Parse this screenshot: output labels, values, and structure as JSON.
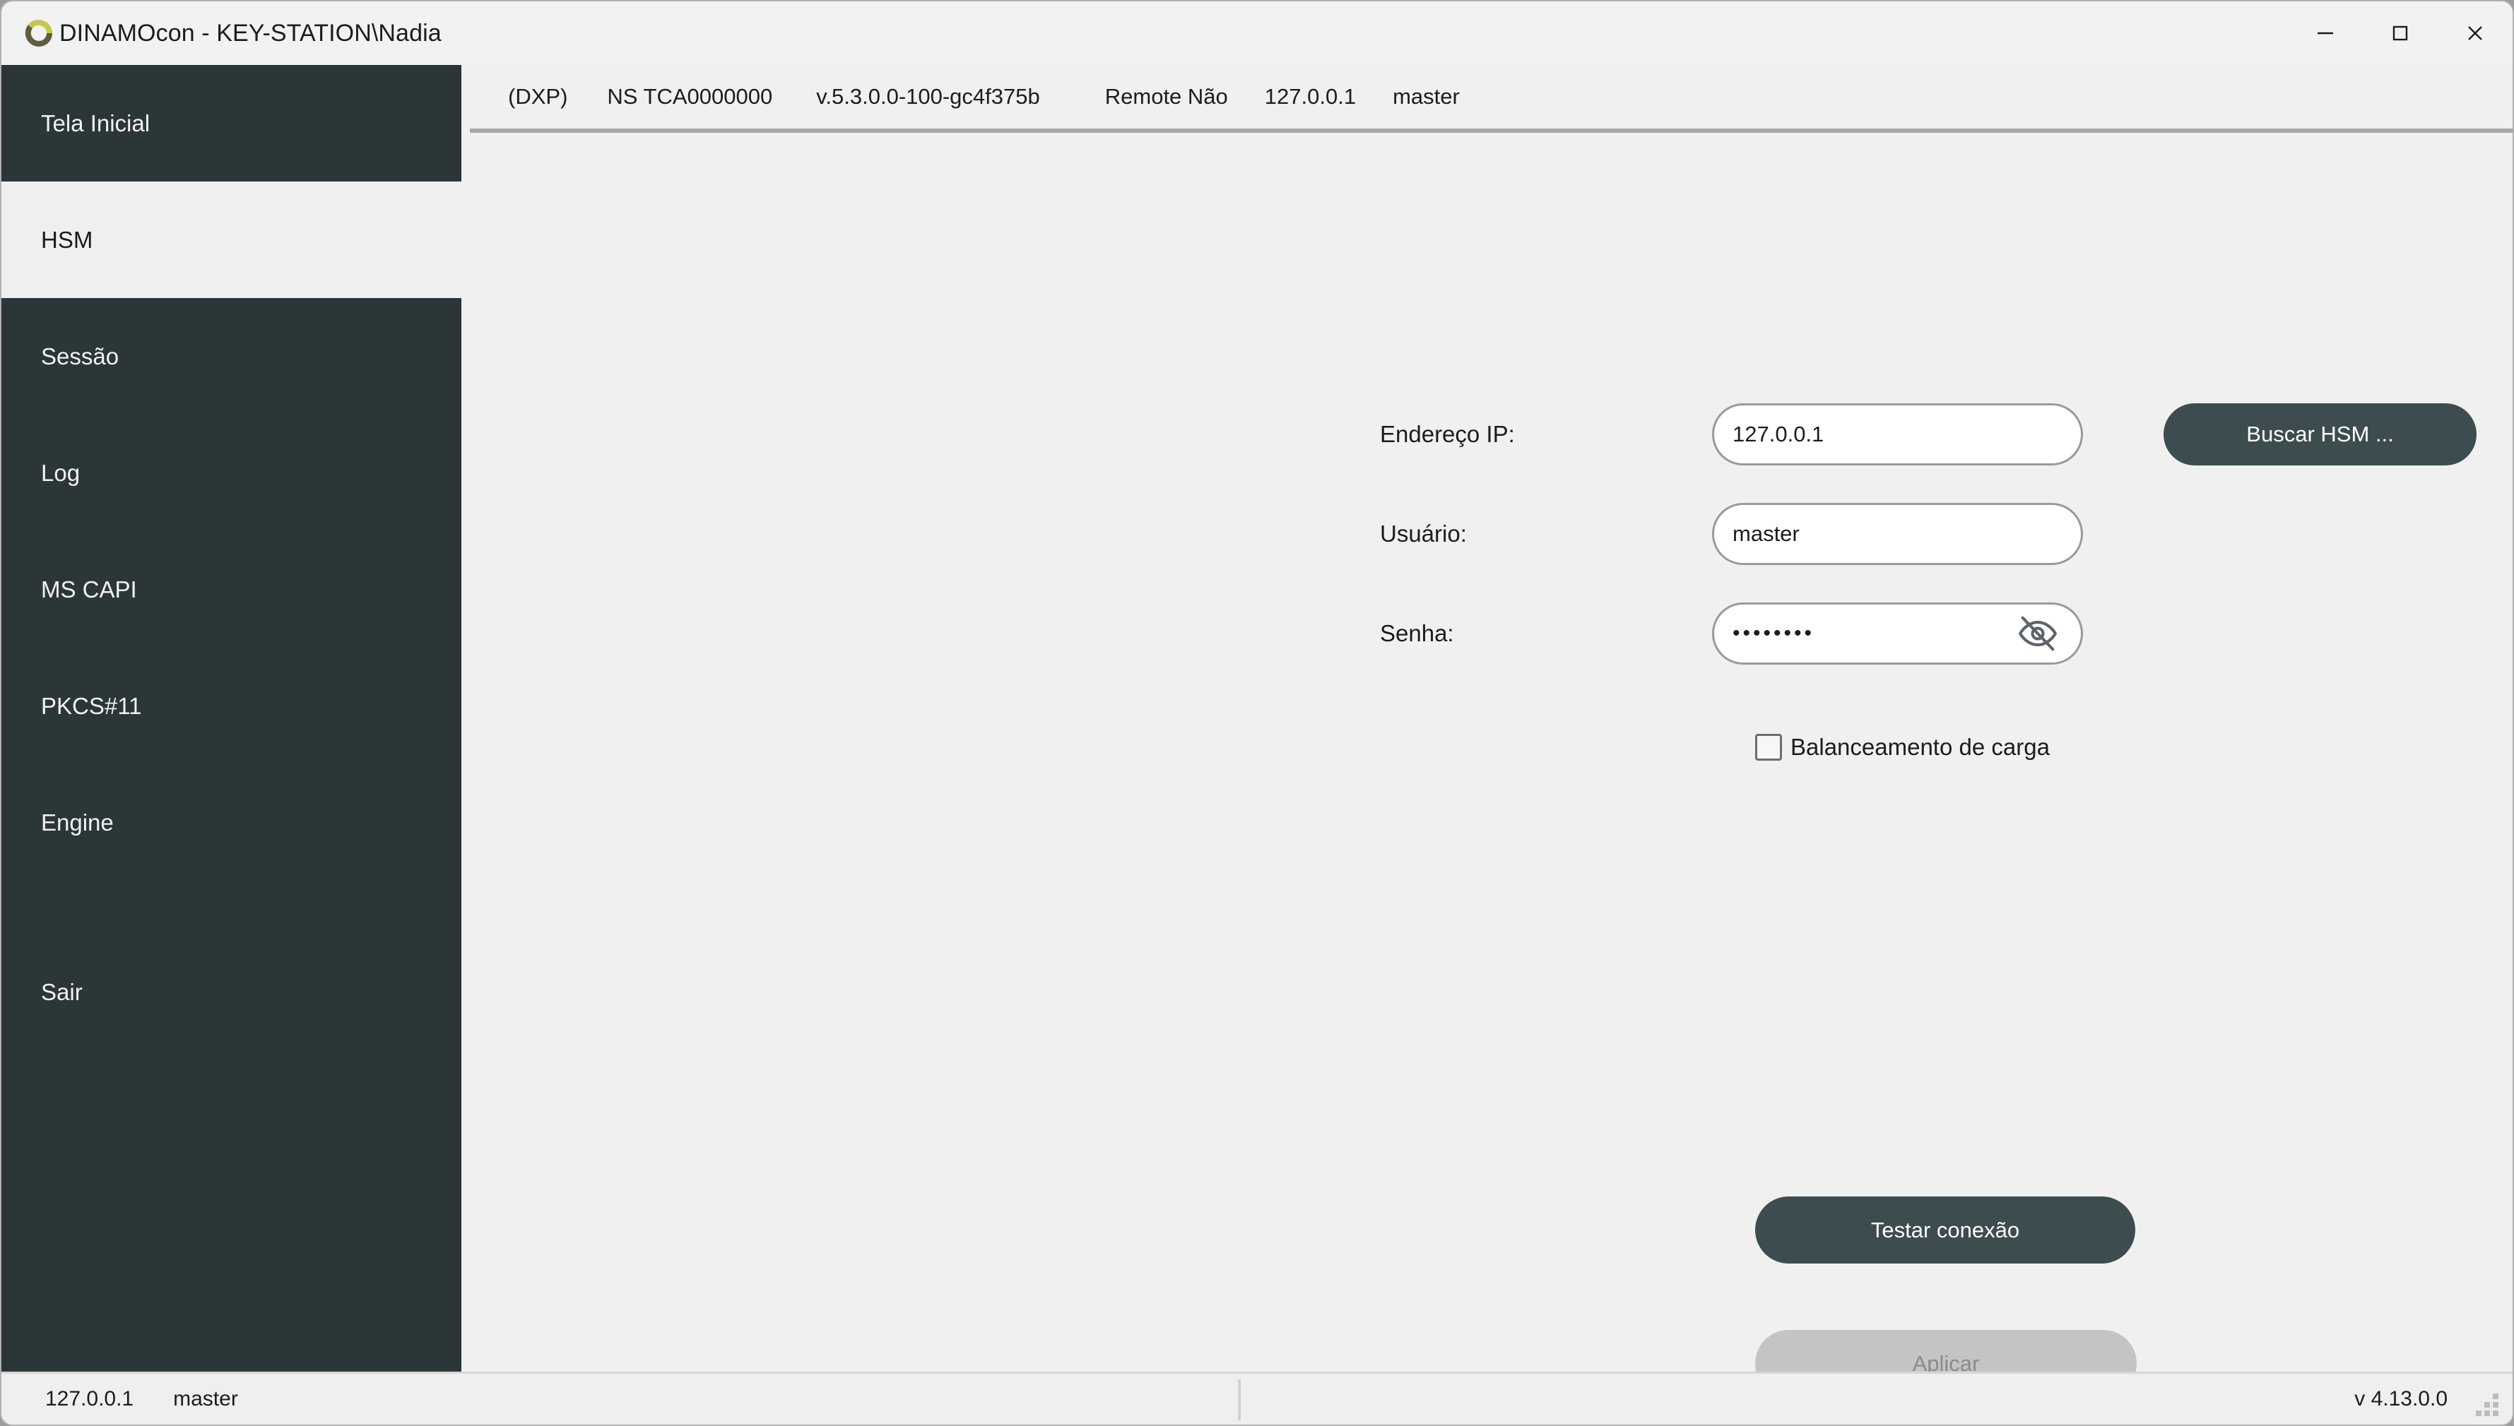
{
  "window": {
    "title": "DINAMOcon - KEY-STATION\\Nadia",
    "logo_icon": "dinamo-ring-logo-icon",
    "logo_color_light": "#c4c94e",
    "logo_color_dark": "#5f5c43",
    "controls": {
      "minimize": "minimize-icon",
      "maximize": "maximize-icon",
      "close": "close-icon"
    }
  },
  "sidebar": {
    "background": "#2b3638",
    "active_background": "#efefef",
    "items": [
      {
        "label": "Tela Inicial",
        "active": false
      },
      {
        "label": "HSM",
        "active": true
      },
      {
        "label": "Sessão",
        "active": false
      },
      {
        "label": "Log",
        "active": false
      },
      {
        "label": "MS CAPI",
        "active": false
      },
      {
        "label": "PKCS#11",
        "active": false
      },
      {
        "label": "Engine",
        "active": false
      },
      {
        "label": "Sair",
        "active": false
      }
    ]
  },
  "info_strip": {
    "dxp": "(DXP)",
    "serial": "NS TCA0000000",
    "version": "v.5.3.0.0-100-gc4f375b",
    "remote": "Remote Não",
    "ip": "127.0.0.1",
    "user": "master"
  },
  "form": {
    "ip": {
      "label": "Endereço IP:",
      "value": "127.0.0.1",
      "placeholder": "127.0.0.1"
    },
    "user": {
      "label": "Usuário:",
      "value": "master",
      "placeholder": "Usuário"
    },
    "password": {
      "label": "Senha:",
      "value": "••••••••",
      "placeholder": "Senha",
      "toggle_icon": "eye-off-icon",
      "masked": true
    },
    "load_balance": {
      "label": "Balanceamento de carga",
      "checked": false
    },
    "buttons": {
      "search_hsm": "Buscar HSM ...",
      "test_connection": "Testar conexão",
      "apply": "Aplicar",
      "apply_enabled": false
    },
    "accent_dark": "#3d4c4f",
    "disabled_bg": "#c4c4c4"
  },
  "statusbar": {
    "ip": "127.0.0.1",
    "user": "master",
    "version": "v 4.13.0.0",
    "grip_icon": "resize-grip-icon"
  }
}
